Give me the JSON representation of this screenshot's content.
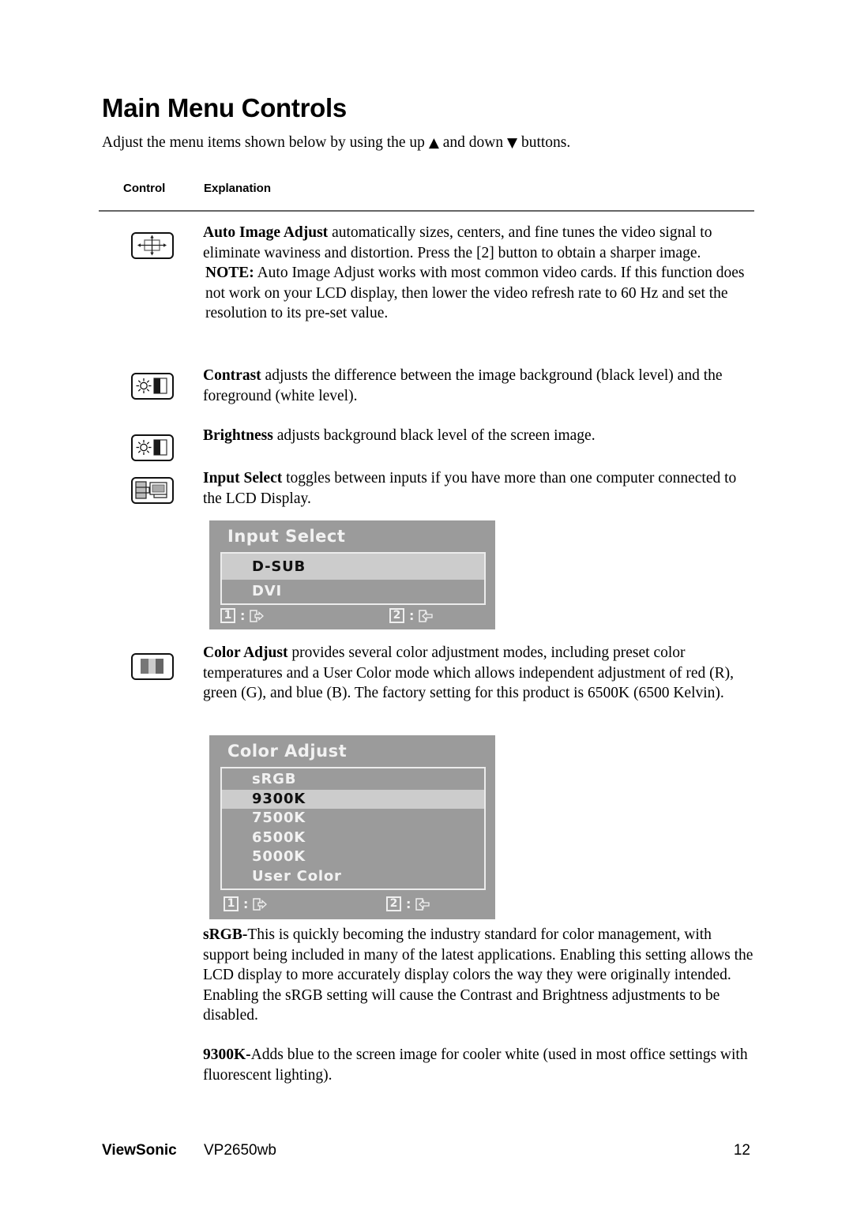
{
  "page": {
    "title": "Main Menu Controls",
    "intro_before_up": "Adjust the menu items shown below by using the up ",
    "up_symbol": "▲",
    "intro_between": " and down ",
    "down_symbol": "▼",
    "intro_after": " buttons."
  },
  "table": {
    "col_control": "Control",
    "col_explanation": "Explanation"
  },
  "controls": [
    {
      "icon": "auto-image-adjust-icon",
      "name": "Auto Image Adjust",
      "text": " automatically sizes, centers, and fine tunes the video signal to eliminate waviness and distortion. Press the [2] button to obtain a sharper image.",
      "note_label": "NOTE:",
      "note_text": " Auto Image Adjust works with most common video cards. If this function does not work on your LCD display, then lower the video refresh rate to 60 Hz and set the resolution to its pre-set value."
    },
    {
      "icon": "contrast-icon",
      "name": "Contrast",
      "text": " adjusts the difference between the image background  (black level) and the foreground (white level)."
    },
    {
      "icon": "brightness-icon",
      "name": "Brightness",
      "text": " adjusts background black level of the screen image."
    },
    {
      "icon": "input-select-icon",
      "name": "Input Select",
      "text": " toggles between inputs if you have more than one computer connected to the LCD Display."
    },
    {
      "icon": "color-adjust-icon",
      "name": "Color Adjust",
      "text": " provides several color adjustment modes, including preset color temperatures and a User Color mode which allows independent adjustment of red (R), green (G), and blue (B). The factory setting for this product is 6500K (6500 Kelvin)."
    }
  ],
  "osd_input_select": {
    "title": "Input Select",
    "options": [
      "D-SUB",
      "DVI"
    ],
    "selected": "D-SUB",
    "key1": "1",
    "key2": "2",
    "key1_icon": "exit-icon",
    "key2_icon": "enter-icon"
  },
  "osd_color_adjust": {
    "title": "Color Adjust",
    "options": [
      "sRGB",
      "9300K",
      "7500K",
      "6500K",
      "5000K",
      "User Color"
    ],
    "selected": "9300K",
    "key1": "1",
    "key2": "2",
    "key1_icon": "exit-icon",
    "key2_icon": "enter-icon"
  },
  "descriptions": [
    {
      "label": "sRGB-",
      "text": "This is quickly becoming the industry standard for color management, with support being included in many of the latest applications. Enabling this setting allows the LCD display to more accurately display colors the way they were originally intended. Enabling the sRGB setting will cause the Contrast and Brightness adjustments to be disabled."
    },
    {
      "label": "9300K-",
      "text": "Adds blue to the screen image for cooler white (used in most office settings with fluorescent lighting)."
    }
  ],
  "footer": {
    "brand": "ViewSonic",
    "model": "VP2650wb",
    "page_number": "12"
  },
  "colors": {
    "osd_background": "#9b9b9b",
    "osd_selected": "#cccccc",
    "osd_text": "#f2f2f2"
  }
}
